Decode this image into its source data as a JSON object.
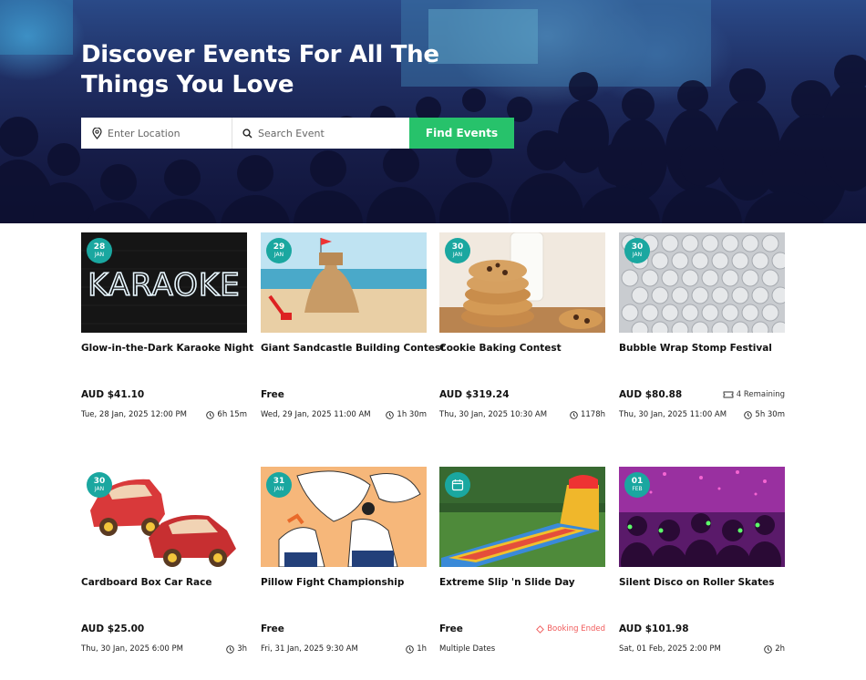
{
  "hero": {
    "title": "Discover Events For All The Things You Love",
    "location_placeholder": "Enter Location",
    "search_placeholder": "Search Event",
    "find_button": "Find Events"
  },
  "events": [
    {
      "day": "28",
      "month": "JAN",
      "title": "Glow-in-the-Dark Karaoke Night",
      "price": "AUD $41.10",
      "tag": "",
      "when": "Tue, 28 Jan, 2025 12:00 PM",
      "duration": "6h 15m",
      "image_text": "KARAOKE"
    },
    {
      "day": "29",
      "month": "JAN",
      "title": "Giant Sandcastle Building Contest",
      "price": "Free",
      "tag": "",
      "when": "Wed, 29 Jan, 2025 11:00 AM",
      "duration": "1h 30m"
    },
    {
      "day": "30",
      "month": "JAN",
      "title": "Cookie Baking Contest",
      "price": "AUD $319.24",
      "tag": "",
      "when": "Thu, 30 Jan, 2025 10:30 AM",
      "duration": "1178h"
    },
    {
      "day": "30",
      "month": "JAN",
      "title": "Bubble Wrap Stomp Festival",
      "price": "AUD $80.88",
      "tag": "4 Remaining",
      "when": "Thu, 30 Jan, 2025 11:00 AM",
      "duration": "5h 30m"
    },
    {
      "day": "30",
      "month": "JAN",
      "title": "Cardboard Box Car Race",
      "price": "AUD $25.00",
      "tag": "",
      "when": "Thu, 30 Jan, 2025 6:00 PM",
      "duration": "3h"
    },
    {
      "day": "31",
      "month": "JAN",
      "title": "Pillow Fight Championship",
      "price": "Free",
      "tag": "",
      "when": "Fri, 31 Jan, 2025 9:30 AM",
      "duration": "1h"
    },
    {
      "day": "",
      "month": "",
      "title": "Extreme Slip 'n Slide Day",
      "price": "Free",
      "tag": "Booking Ended",
      "when": "Multiple Dates",
      "duration": ""
    },
    {
      "day": "01",
      "month": "FEB",
      "title": "Silent Disco on Roller Skates",
      "price": "AUD $101.98",
      "tag": "",
      "when": "Sat, 01 Feb, 2025 2:00 PM",
      "duration": "2h"
    }
  ],
  "colors": {
    "accent": "#1aa7a0",
    "button": "#27c26b",
    "booking_ended": "#f05a5a"
  }
}
